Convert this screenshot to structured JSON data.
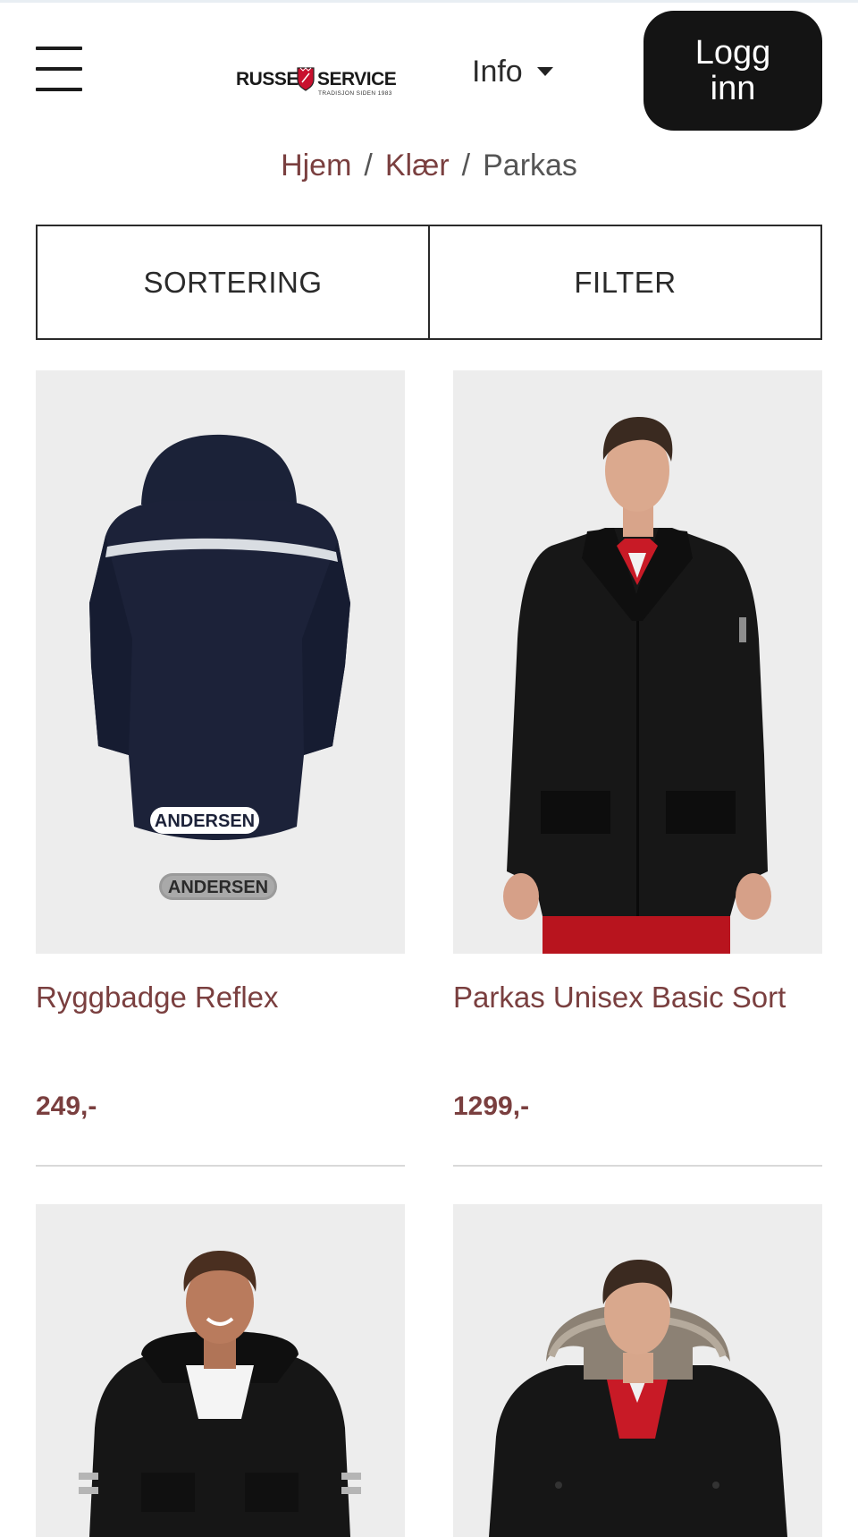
{
  "header": {
    "logo_left": "RUSSE",
    "logo_right": "SERVICE",
    "logo_tagline": "TRADISJON SIDEN 1983",
    "info_label": "Info",
    "login_label": "Logg inn"
  },
  "breadcrumb": {
    "items": [
      {
        "label": "Hjem"
      },
      {
        "label": "Klær"
      }
    ],
    "current": "Parkas",
    "separator": "/"
  },
  "controls": {
    "sort_label": "SORTERING",
    "filter_label": "FILTER"
  },
  "products": [
    {
      "title": "Ryggbadge Reflex",
      "price": "249,-",
      "image_text": "ANDERSEN",
      "badge_text": "ANDERSEN"
    },
    {
      "title": "Parkas Unisex Basic Sort",
      "price": "1299,-"
    },
    {
      "title": "",
      "price": ""
    },
    {
      "title": "",
      "price": ""
    }
  ],
  "colors": {
    "accent": "#7a3f3f",
    "button_bg": "#141414",
    "image_bg": "#ededed"
  }
}
